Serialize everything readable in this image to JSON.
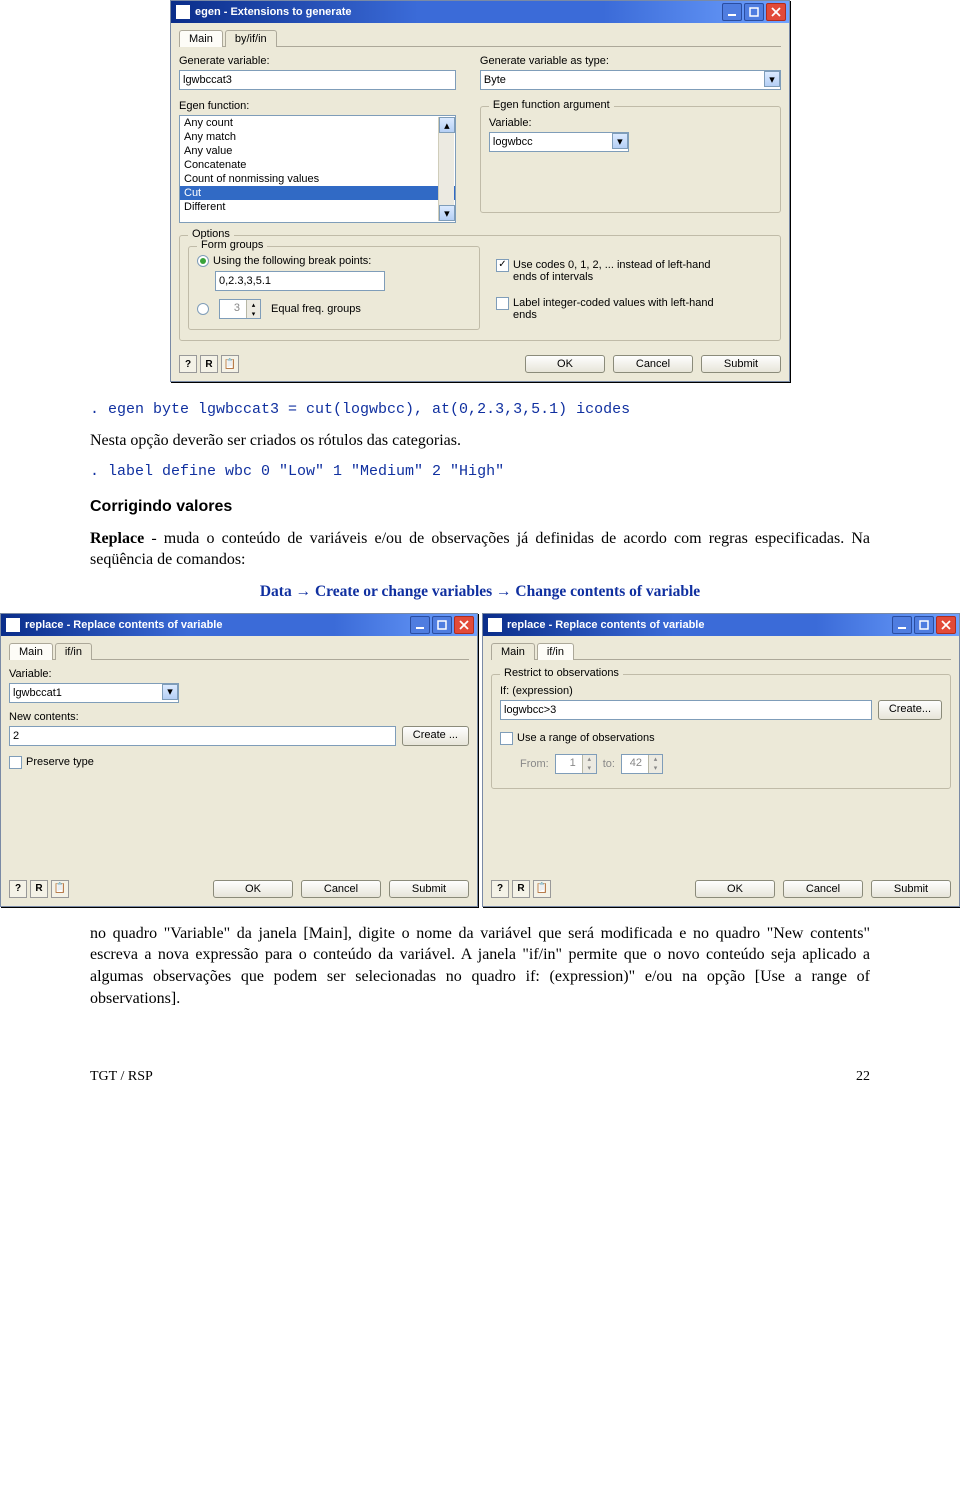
{
  "egen_dialog": {
    "title": "egen - Extensions to generate",
    "tabs": {
      "main": "Main",
      "byifin": "by/if/in"
    },
    "genvar_label": "Generate variable:",
    "genvar_value": "lgwbccat3",
    "genvarastype_label": "Generate variable as type:",
    "genvarastype_value": "Byte",
    "egenfunc_label": "Egen function:",
    "egenfunc_items": [
      "Any count",
      "Any match",
      "Any value",
      "Concatenate",
      "Count of nonmissing values",
      "Cut",
      "Different"
    ],
    "egenfunc_selected_idx": 5,
    "egenarg_group": "Egen function argument",
    "arg_var_label": "Variable:",
    "arg_var_value": "logwbcc",
    "options_group": "Options",
    "formgroups_group": "Form groups",
    "r_breakpoints": "Using the following break points:",
    "breakpoints_value": "0,2.3,3,5.1",
    "r_eqfreq_val": "3",
    "r_eqfreq_label": "Equal freq. groups",
    "chk_usecodes": "Use codes 0, 1, 2, ... instead of left-hand ends of intervals",
    "chk_labelint": "Label integer-coded values with left-hand ends",
    "buttons": {
      "ok": "OK",
      "cancel": "Cancel",
      "submit": "Submit"
    }
  },
  "prose": {
    "cmd1": ". egen byte lgwbccat3 = cut(logwbcc), at(0,2.3,3,5.1) icodes",
    "p1": "Nesta opção deverão ser criados os rótulos das categorias.",
    "cmd2": ". label define wbc 0 \"Low\" 1 \"Medium\" 2 \"High\"",
    "h1": "Corrigindo valores",
    "p2a": "Replace",
    "p2b": " - muda o conteúdo de variáveis e/ou de observações já definidas de acordo com regras especificadas. Na seqüência de comandos:",
    "seq": "Data → Create or change variables → Change contents of variable",
    "p3": "no quadro \"Variable\" da janela [Main], digite o nome da variável que será modificada e no quadro \"New contents\" escreva a nova expressão para o conteúdo da variável. A janela \"if/in\" permite que o novo conteúdo seja aplicado a algumas observações que podem ser selecionadas no quadro if: (expression)\" e/ou na opção [Use a range of observations].",
    "new_contents_strong": "\"New contents\""
  },
  "replace_main": {
    "title": "replace - Replace contents of variable",
    "tabs": {
      "main": "Main",
      "ifin": "if/in"
    },
    "var_label": "Variable:",
    "var_value": "lgwbccat1",
    "new_label": "New contents:",
    "new_value": "2",
    "create_btn": "Create ...",
    "chk_preserve": "Preserve type",
    "buttons": {
      "ok": "OK",
      "cancel": "Cancel",
      "submit": "Submit"
    }
  },
  "replace_ifin": {
    "title": "replace - Replace contents of variable",
    "tabs": {
      "main": "Main",
      "ifin": "if/in"
    },
    "group_title": "Restrict to observations",
    "ifexpr_label": "If: (expression)",
    "ifexpr_value": "logwbcc>3",
    "create_btn": "Create...",
    "chk_range": "Use a range of observations",
    "from_label": "From:",
    "from_value": "1",
    "to_label": "to:",
    "to_value": "42",
    "buttons": {
      "ok": "OK",
      "cancel": "Cancel",
      "submit": "Submit"
    }
  },
  "footer": {
    "left": "TGT / RSP",
    "right": "22"
  }
}
